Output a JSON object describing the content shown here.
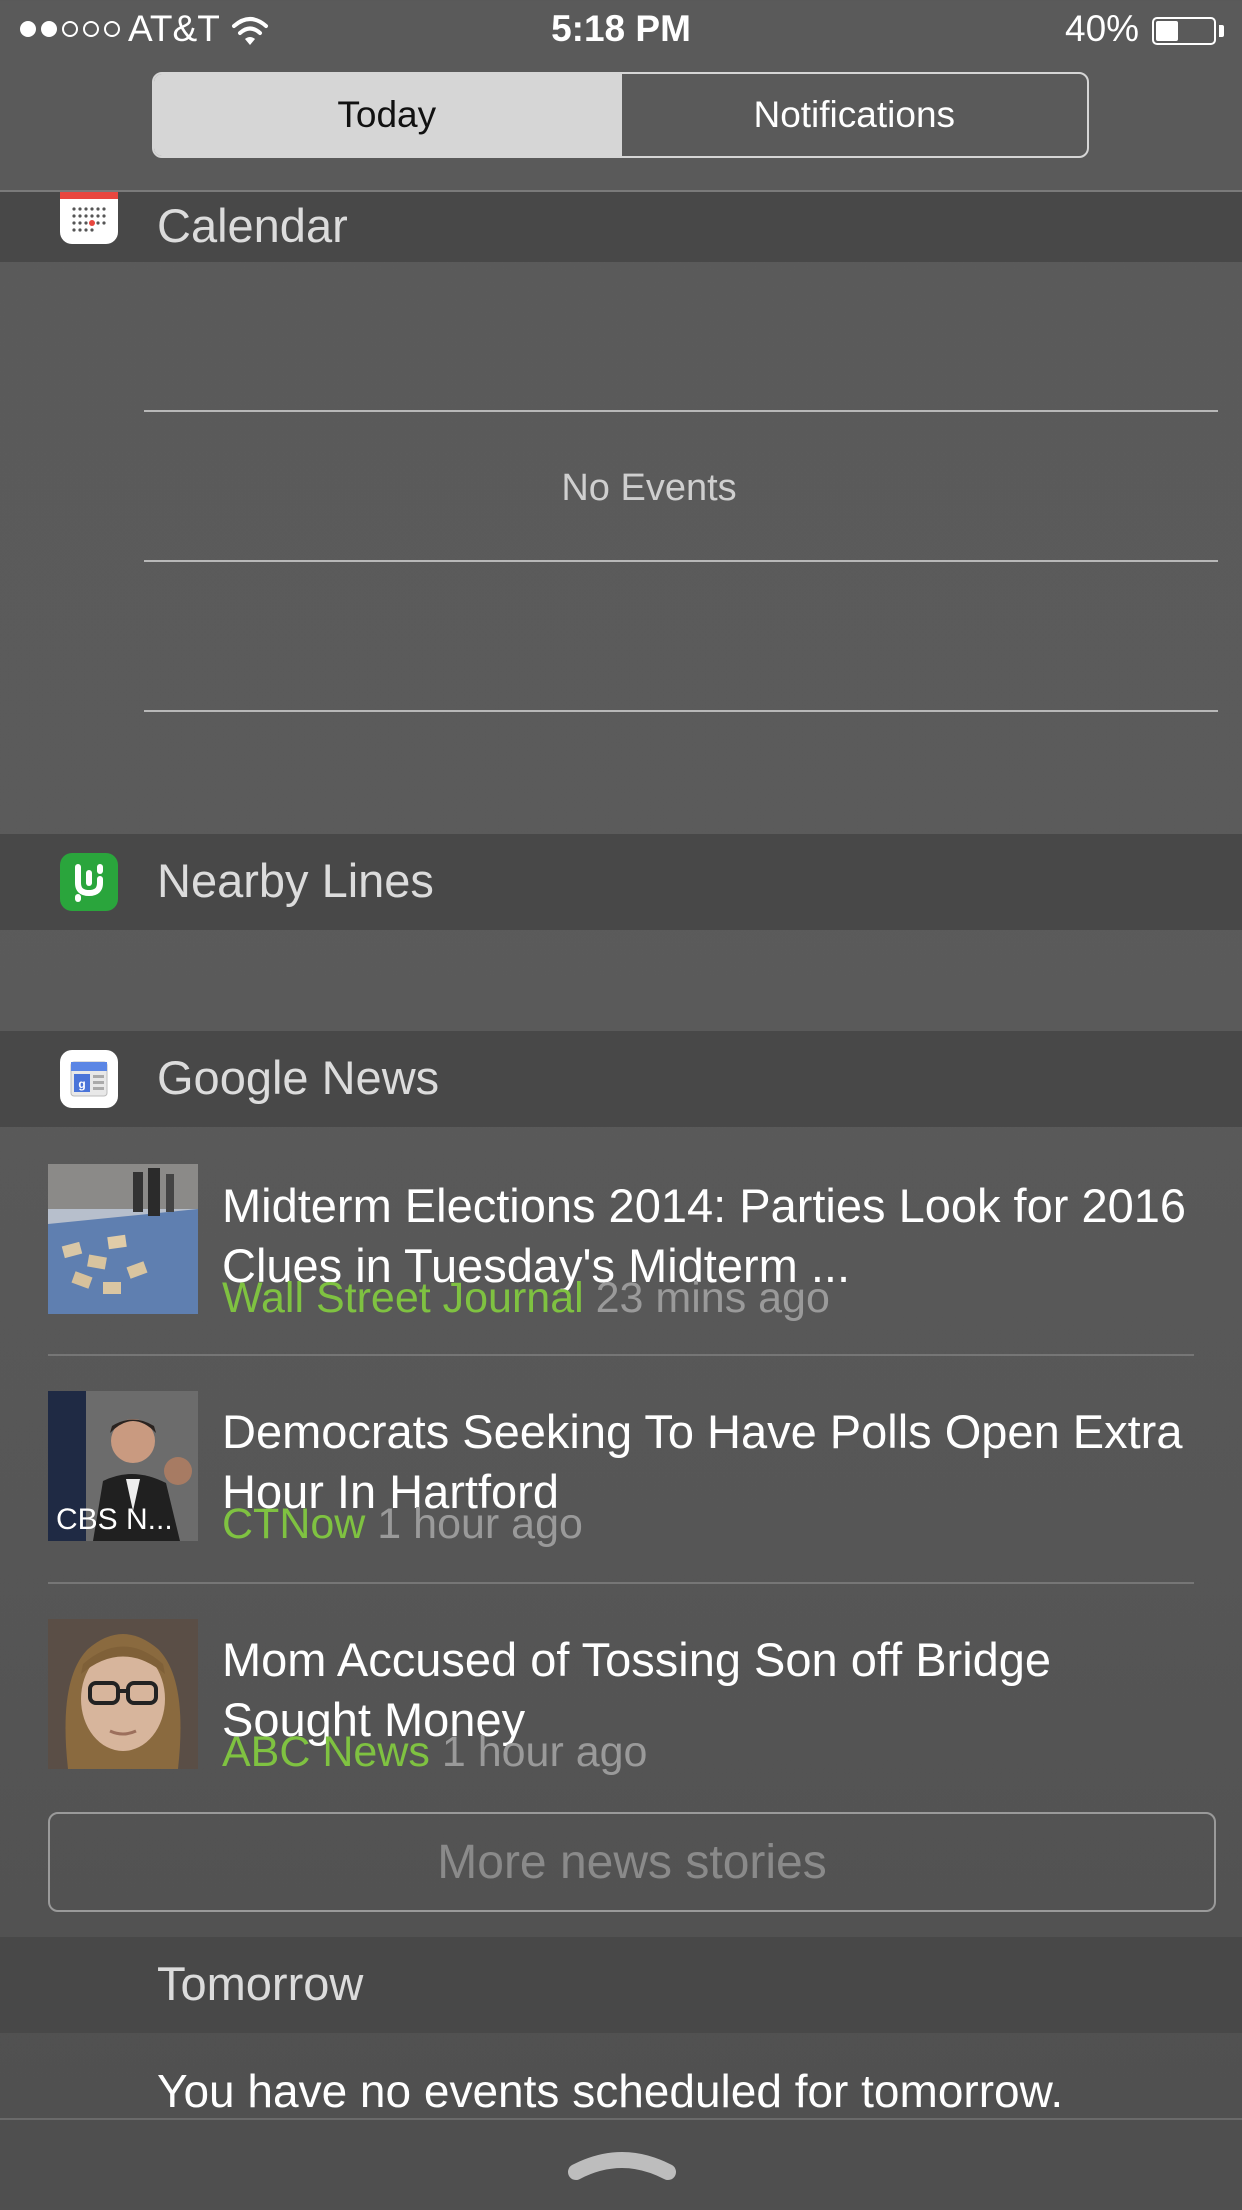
{
  "status_bar": {
    "carrier": "AT&T",
    "time": "5:18 PM",
    "battery_percent": "40%",
    "battery_level": 0.4,
    "signal_bars_filled": 2,
    "signal_bars_total": 5
  },
  "segmented_control": {
    "today_label": "Today",
    "notifications_label": "Notifications",
    "selected": "Today"
  },
  "calendar": {
    "title": "Calendar",
    "no_events": "No Events"
  },
  "nearby_lines": {
    "title": "Nearby Lines"
  },
  "google_news": {
    "title": "Google News",
    "items": [
      {
        "headline": "Midterm Elections 2014: Parties Look for 2016 Clues in Tuesday's Midterm ...",
        "source": "Wall Street Journal",
        "time": "23 mins ago"
      },
      {
        "headline": "Democrats Seeking To Have Polls Open Extra Hour In Hartford",
        "source": "CTNow",
        "time": "1 hour ago",
        "thumb_caption": "CBS N..."
      },
      {
        "headline": "Mom Accused of Tossing Son off Bridge Sought Money",
        "source": "ABC News",
        "time": "1 hour ago"
      }
    ],
    "more_label": "More news stories"
  },
  "tomorrow": {
    "title": "Tomorrow",
    "text": "You have no events scheduled for tomorrow."
  },
  "colors": {
    "source_green": "#7fc241",
    "transit_green": "#2aa53c",
    "calendar_red": "#e8473f"
  }
}
